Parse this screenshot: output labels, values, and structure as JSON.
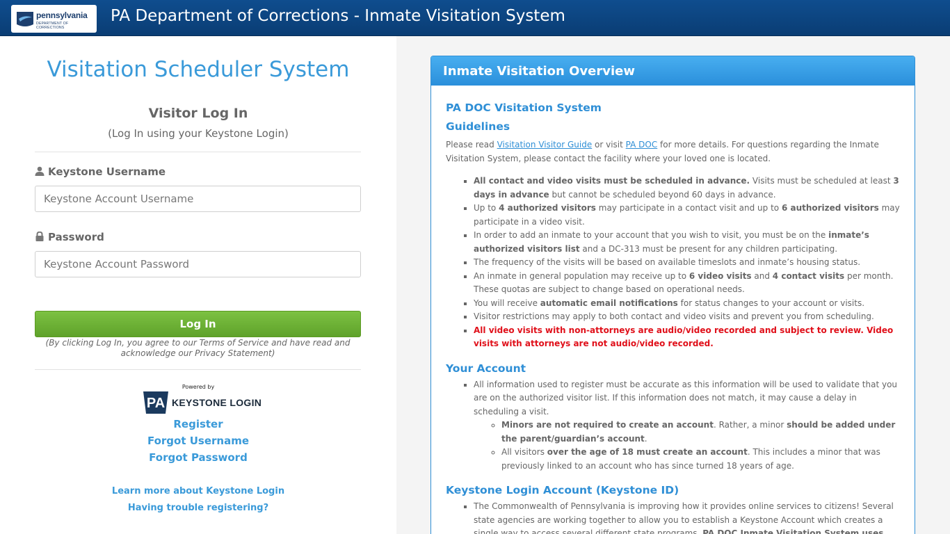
{
  "header": {
    "logo_text": "pennsylvania",
    "logo_sub": "DEPARTMENT OF CORRECTIONS",
    "title": "PA Department of Corrections - Inmate Visitation System"
  },
  "login": {
    "main_title": "Visitation Scheduler System",
    "heading": "Visitor Log In",
    "subheading": "(Log In using your Keystone Login)",
    "username_label": "Keystone Username",
    "username_placeholder": "Keystone Account Username",
    "username_value": "",
    "password_label": "Password",
    "password_placeholder": "Keystone Account Password",
    "password_value": "",
    "button_label": "Log In",
    "terms": "(By clicking Log In, you agree to our Terms of Service and have read and acknowledge our Privacy Statement)",
    "powered_by": "Powered by",
    "keystone_badge": "PA",
    "keystone_logo_text": "KEYSTONE LOGIN",
    "links": {
      "register": "Register",
      "forgot_username": "Forgot Username",
      "forgot_password": "Forgot Password",
      "learn_more": "Learn more about Keystone Login",
      "trouble": "Having trouble registering?"
    }
  },
  "overview": {
    "panel_title": "Inmate Visitation Overview",
    "system_heading": "PA DOC Visitation System",
    "guidelines_heading": "Guidelines",
    "intro": {
      "pre": "Please read ",
      "link1": "Visitation Visitor Guide",
      "mid": " or visit ",
      "link2": "PA DOC",
      "post": " for more details. For questions regarding the Inmate Visitation System, please contact the facility where your loved one is located."
    },
    "guidelines": {
      "g1_b1": "All contact and video visits must be scheduled in advance.",
      "g1_t1": " Visits must be scheduled at least ",
      "g1_b2": "3 days in advance",
      "g1_t2": " but cannot be scheduled beyond 60 days in advance.",
      "g2_t1": "Up to ",
      "g2_b1": "4 authorized visitors",
      "g2_t2": " may participate in a contact visit and up to ",
      "g2_b2": "6 authorized visitors",
      "g2_t3": " may participate in a video visit.",
      "g3_t1": "In order to add an inmate to your account that you wish to visit, you must be on the ",
      "g3_b1": "inmate’s authorized visitors list",
      "g3_t2": " and a DC-313 must be present for any children participating.",
      "g4": "The frequency of the visits will be based on available timeslots and inmate’s housing status.",
      "g5_t1": "An inmate in general population may receive up to ",
      "g5_b1": "6 video visits",
      "g5_t2": " and ",
      "g5_b2": "4 contact visits",
      "g5_t3": " per month. These quotas are subject to change based on operational needs.",
      "g6_t1": "You will receive ",
      "g6_b1": "automatic email notifications",
      "g6_t2": " for status changes to your account or visits.",
      "g7": "Visitor restrictions may apply to both contact and video visits and prevent you from scheduling.",
      "g8": "All video visits with non-attorneys are audio/video recorded and subject to review. Video visits with attorneys are not audio/video recorded."
    },
    "account_heading": "Your Account",
    "account": {
      "a1": "All information used to register must be accurate as this information will be used to validate that you are on the authorized visitor list. If this information does not match, it may cause a delay in scheduling a visit.",
      "a2_b1": "Minors are not required to create an account",
      "a2_t1": ". Rather, a minor ",
      "a2_b2": "should be added under the parent/guardian’s account",
      "a2_t2": ".",
      "a3_t1": "All visitors ",
      "a3_b1": "over the age of 18 must create an account",
      "a3_t2": ". This includes a minor that was previously linked to an account who has since turned 18 years of age."
    },
    "keystone_heading": "Keystone Login Account (Keystone ID)",
    "keystone": {
      "k1_t1": "The Commonwealth of Pennsylvania is improving how it provides online services to citizens! Several state agencies are working together to allow you to establish a Keystone Account which creates a single way to access several different state programs. ",
      "k1_b1": "PA DOC Inmate Visitation System uses Keystone Account to"
    }
  },
  "colors": {
    "header_bg": "#0a3d74",
    "accent_blue": "#3a9ad9",
    "login_green": "#6ab334",
    "alert_red": "#e0101a"
  }
}
